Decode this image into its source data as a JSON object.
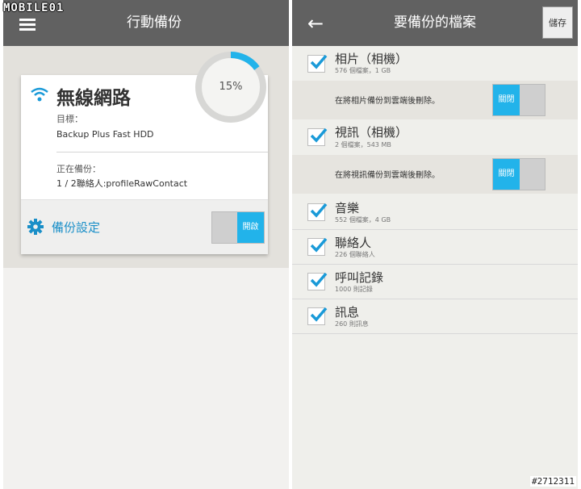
{
  "watermark": "MOBILE01",
  "post_id": "#2712311",
  "left_screen": {
    "title": "行動備份",
    "card": {
      "network_name": "無線網路",
      "target_label": "目標：",
      "target_value": "Backup Plus Fast HDD",
      "status_label": "正在備份：",
      "status_value": "1 / 2聯絡人:profileRawContact"
    },
    "progress": {
      "percent_text": "15%",
      "fraction": 0.15
    },
    "settings": {
      "label": "備份設定",
      "toggle_label": "開啟",
      "toggle_on": true
    }
  },
  "right_screen": {
    "title": "要備份的檔案",
    "save_label": "儲存",
    "items": [
      {
        "title": "相片（相機）",
        "subtitle": "576 個檔案，1 GB",
        "checked": true
      },
      {
        "title": "視訊（相機）",
        "subtitle": "2 個檔案，543 MB",
        "checked": true
      },
      {
        "title": "音樂",
        "subtitle": "552 個檔案，4 GB",
        "checked": true
      },
      {
        "title": "聯絡人",
        "subtitle": "226 個聯絡人",
        "checked": true
      },
      {
        "title": "呼叫記錄",
        "subtitle": "1000 則記錄",
        "checked": true
      },
      {
        "title": "訊息",
        "subtitle": "260 則訊息",
        "checked": true
      }
    ],
    "photo_delete": {
      "label": "在將相片備份到雲端後刪除。",
      "toggle_label": "關閉",
      "toggle_on": false
    },
    "video_delete": {
      "label": "在將視訊備份到雲端後刪除。",
      "toggle_label": "關閉",
      "toggle_on": false
    }
  },
  "colors": {
    "accent": "#22b3ea",
    "header": "#616161",
    "checkmark": "#1a9ad8"
  }
}
